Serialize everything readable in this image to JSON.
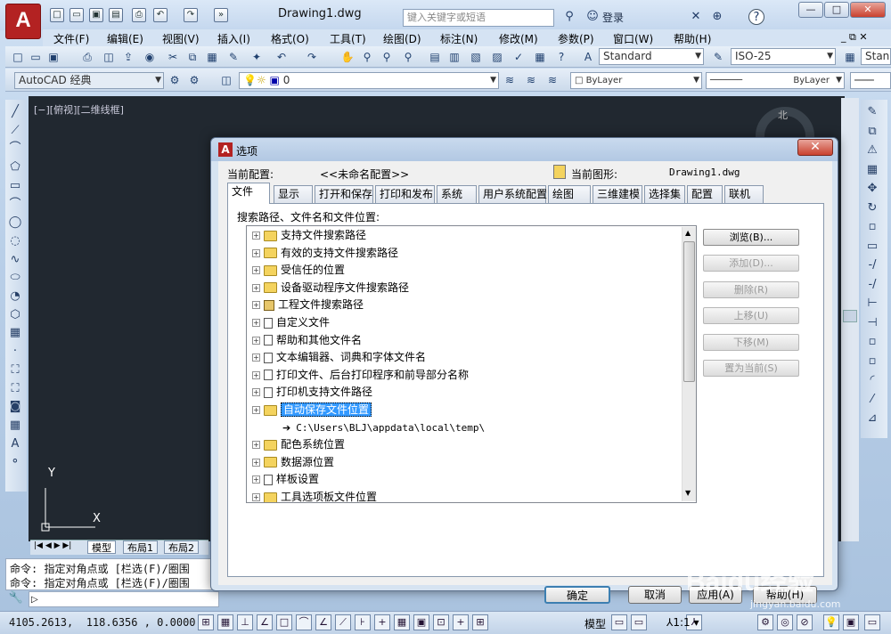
{
  "title": {
    "doc": "Drawing1.dwg",
    "search_placeholder": "键入关键字或短语",
    "login": "登录",
    "help": "?"
  },
  "menu": [
    "文件(F)",
    "编辑(E)",
    "视图(V)",
    "插入(I)",
    "格式(O)",
    "工具(T)",
    "绘图(D)",
    "标注(N)",
    "修改(M)",
    "参数(P)",
    "窗口(W)",
    "帮助(H)"
  ],
  "toolbar": {
    "textstyle": "Standard",
    "dimstyle": "ISO-25",
    "tablestyle": "Stan",
    "workspace": "AutoCAD 经典",
    "layer": "0",
    "color": "ByLayer",
    "linetype": "ByLayer"
  },
  "canvas": {
    "view_label": "[−][俯视][二维线框]",
    "compass_north": "北",
    "ucs_x": "X",
    "ucs_y": "Y"
  },
  "layout_tabs": [
    "模型",
    "布局1",
    "布局2"
  ],
  "command": {
    "line1": "命令: 指定对角点或 [栏选(F)/圈围",
    "line2": "命令: 指定对角点或 [栏选(F)/圈围"
  },
  "status": {
    "coords": "4105.2613,  118.6356 , 0.0000",
    "model": "模型",
    "scale": "1:1"
  },
  "dialog": {
    "title": "选项",
    "cur_profile_label": "当前配置:",
    "cur_profile": "<<未命名配置>>",
    "cur_drawing_label": "当前图形:",
    "cur_drawing": "Drawing1.dwg",
    "tabs": [
      "文件",
      "显示",
      "打开和保存",
      "打印和发布",
      "系统",
      "用户系统配置",
      "绘图",
      "三维建模",
      "选择集",
      "配置",
      "联机"
    ],
    "panel_label": "搜索路径、文件名和文件位置:",
    "tree": [
      {
        "label": "支持文件搜索路径",
        "icon": "folder"
      },
      {
        "label": "有效的支持文件搜索路径",
        "icon": "folder"
      },
      {
        "label": "受信任的位置",
        "icon": "folder"
      },
      {
        "label": "设备驱动程序文件搜索路径",
        "icon": "folder"
      },
      {
        "label": "工程文件搜索路径",
        "icon": "book"
      },
      {
        "label": "自定义文件",
        "icon": "doc"
      },
      {
        "label": "帮助和其他文件名",
        "icon": "doc"
      },
      {
        "label": "文本编辑器、词典和字体文件名",
        "icon": "doc"
      },
      {
        "label": "打印文件、后台打印程序和前导部分名称",
        "icon": "doc"
      },
      {
        "label": "打印机支持文件路径",
        "icon": "doc"
      },
      {
        "label": "自动保存文件位置",
        "icon": "folder"
      },
      {
        "label": "C:\\Users\\BLJ\\appdata\\local\\temp\\",
        "icon": "arrow"
      },
      {
        "label": "配色系统位置",
        "icon": "folder"
      },
      {
        "label": "数据源位置",
        "icon": "folder"
      },
      {
        "label": "样板设置",
        "icon": "doc"
      },
      {
        "label": "工具选项板文件位置",
        "icon": "folder"
      }
    ],
    "side_buttons": [
      "浏览(B)...",
      "添加(D)...",
      "删除(R)",
      "上移(U)",
      "下移(M)",
      "置为当前(S)"
    ],
    "footer": [
      "确定",
      "取消",
      "应用(A)",
      "帮助(H)"
    ]
  },
  "watermark": {
    "brand": "Baidu经验",
    "url": "jingyan.baidu.com"
  }
}
